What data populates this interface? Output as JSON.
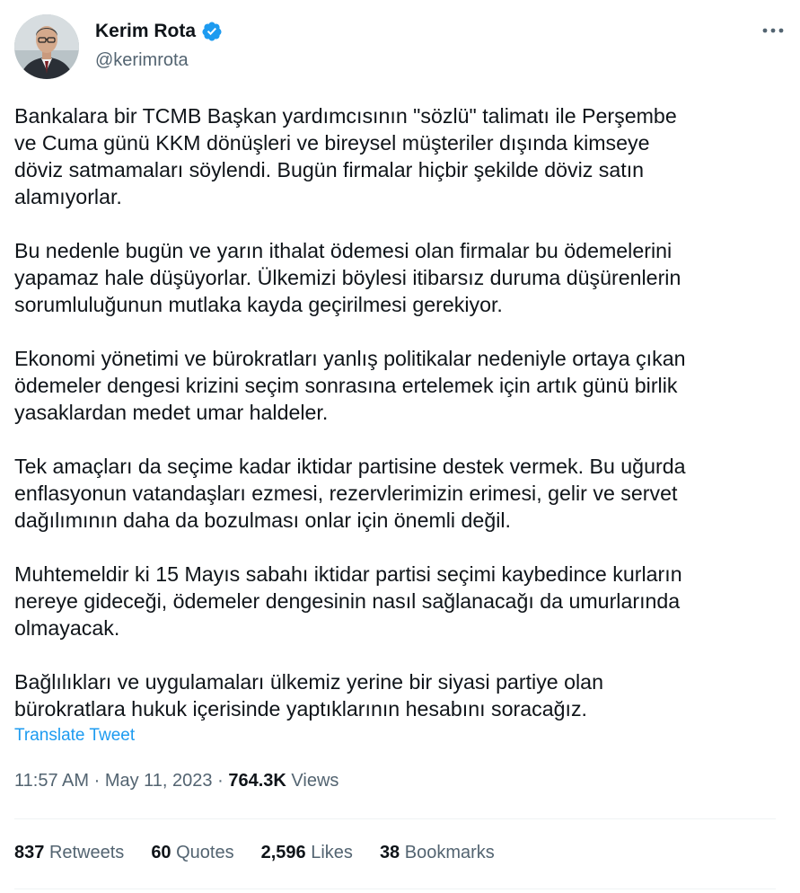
{
  "author": {
    "display_name": "Kerim Rota",
    "handle": "@kerimrota",
    "verified_icon": "verified-badge-icon",
    "verified_color": "#1d9bf0"
  },
  "tweet": {
    "paragraphs": [
      "Bankalara bir TCMB Başkan yardımcısının \"sözlü\" talimatı ile Perşembe\nve Cuma günü KKM dönüşleri ve bireysel müşteriler dışında kimseye\ndöviz satmamaları söylendi. Bugün firmalar hiçbir şekilde döviz satın\nalamıyorlar.",
      "Bu nedenle bugün ve yarın ithalat ödemesi olan firmalar bu ödemelerini\nyapamaz hale düşüyorlar. Ülkemizi böylesi itibarsız duruma düşürenlerin\nsorumluluğunun mutlaka kayda geçirilmesi gerekiyor.",
      "Ekonomi yönetimi ve bürokratları yanlış politikalar nedeniyle ortaya çıkan\nödemeler dengesi krizini seçim sonrasına ertelemek için artık günü birlik\nyasaklardan medet umar haldeler.",
      "Tek amaçları da seçime kadar iktidar partisine destek vermek. Bu uğurda\nenflasyonun vatandaşları ezmesi, rezervlerimizin erimesi, gelir ve servet\ndağılımının daha da bozulması onlar için önemli değil.",
      "Muhtemeldir ki 15 Mayıs sabahı iktidar partisi seçimi kaybedince kurların\nnereye gideceği, ödemeler dengesinin nasıl sağlanacağı da umurlarında\nolmayacak.",
      "Bağlılıkları ve uygulamaları ülkemiz yerine bir siyasi partiye olan\nbürokratlara hukuk içerisinde yaptıklarının hesabını soracağız."
    ],
    "translate_label": "Translate Tweet",
    "time": "11:57 AM",
    "separator": "·",
    "date": "May 11, 2023",
    "views_count": "764.3K",
    "views_label": "Views"
  },
  "stats": {
    "retweets_count": "837",
    "retweets_label": "Retweets",
    "quotes_count": "60",
    "quotes_label": "Quotes",
    "likes_count": "2,596",
    "likes_label": "Likes",
    "bookmarks_count": "38",
    "bookmarks_label": "Bookmarks"
  },
  "colors": {
    "text": "#0f1419",
    "secondary": "#536471",
    "link": "#1d9bf0",
    "divider": "#eff3f4"
  },
  "icons": {
    "more": "more-horizontal-icon"
  }
}
